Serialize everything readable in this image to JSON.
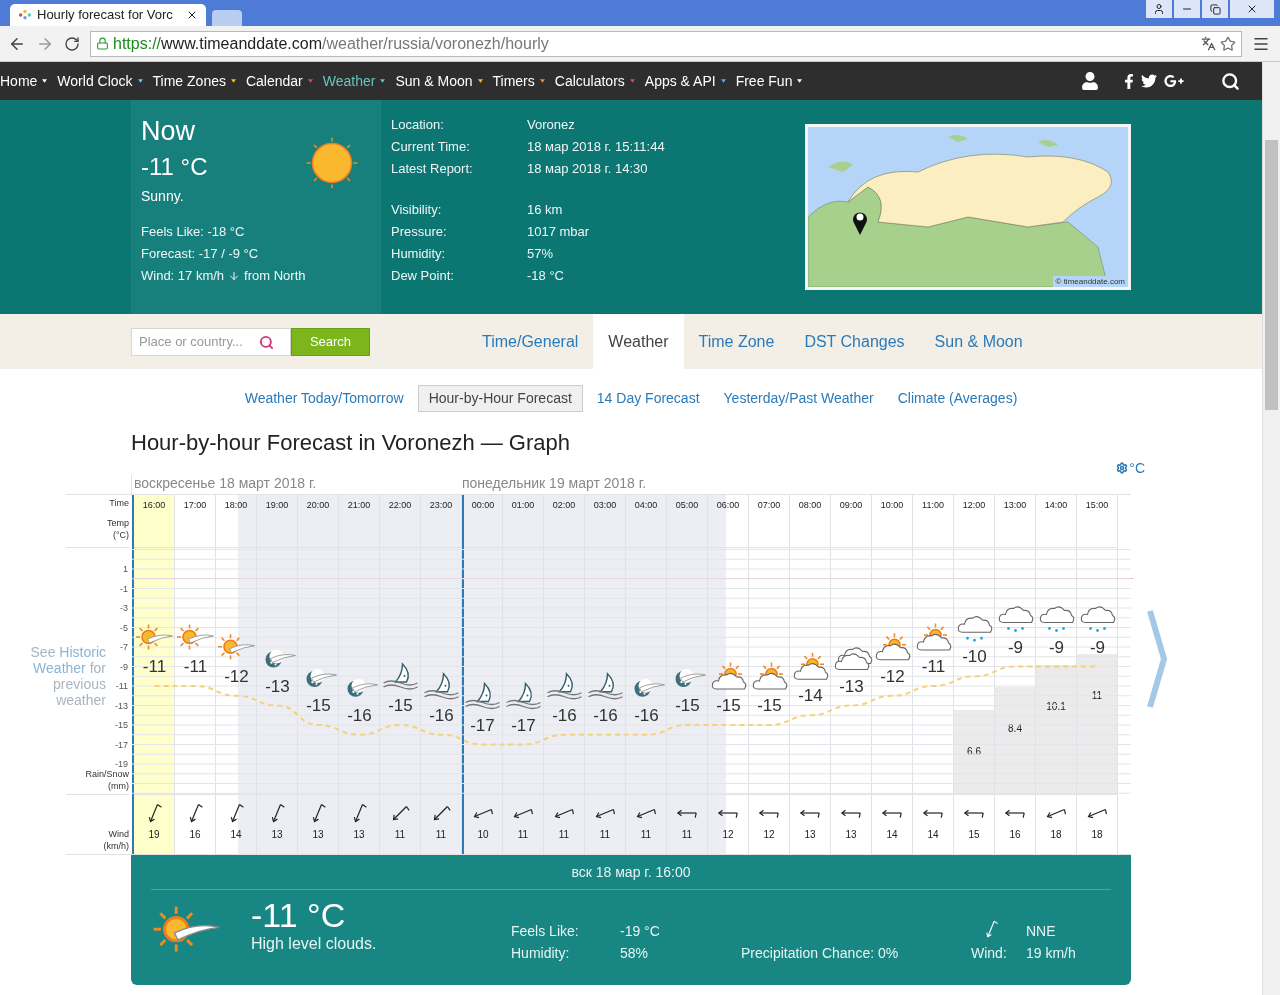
{
  "browser": {
    "tab_title": "Hourly forecast for Vorc",
    "url_scheme": "https://",
    "url_host": "www.timeanddate.com",
    "url_path": "/weather/russia/voronezh/hourly"
  },
  "nav": {
    "items": [
      {
        "label": "Home",
        "selected": false,
        "color": "#ffffff"
      },
      {
        "label": "World Clock",
        "selected": false,
        "color": "#6ec6e6"
      },
      {
        "label": "Time Zones",
        "selected": false,
        "color": "#f2c12e"
      },
      {
        "label": "Calendar",
        "selected": false,
        "color": "#e04b4b"
      },
      {
        "label": "Weather",
        "selected": true,
        "color": "#65c4bc"
      },
      {
        "label": "Sun & Moon",
        "selected": false,
        "color": "#f2c12e"
      },
      {
        "label": "Timers",
        "selected": false,
        "color": "#f08a3c"
      },
      {
        "label": "Calculators",
        "selected": false,
        "color": "#e04b4b"
      },
      {
        "label": "Apps & API",
        "selected": false,
        "color": "#6ea0e6"
      },
      {
        "label": "Free Fun",
        "selected": false,
        "color": "#ffffff"
      }
    ]
  },
  "now": {
    "title": "Now",
    "temp": "-11 °C",
    "condition": "Sunny.",
    "lines": [
      "Feels Like: -18 °C",
      "Forecast: -17 / -9 °C"
    ],
    "wind_speed": "Wind: 17 km/h",
    "wind_direction": "from North"
  },
  "detail_groups": [
    {
      "rows": [
        {
          "label": "Location:",
          "value": "Voronez"
        },
        {
          "label": "Current Time:",
          "value": "18 мар 2018 г. 15:11:44"
        },
        {
          "label": "Latest Report:",
          "value": "18 мар 2018 г. 14:30"
        }
      ]
    },
    {
      "rows": [
        {
          "label": "Visibility:",
          "value": "16 km"
        },
        {
          "label": "Pressure:",
          "value": "1017 mbar"
        },
        {
          "label": "Humidity:",
          "value": "57%"
        },
        {
          "label": "Dew Point:",
          "value": "-18 °C"
        }
      ]
    }
  ],
  "map": {
    "credit": "© timeanddate.com"
  },
  "search": {
    "placeholder": "Place or country...",
    "button": "Search"
  },
  "section_tabs": [
    {
      "label": "Time/General",
      "selected": false
    },
    {
      "label": "Weather",
      "selected": true
    },
    {
      "label": "Time Zone",
      "selected": false
    },
    {
      "label": "DST Changes",
      "selected": false
    },
    {
      "label": "Sun & Moon",
      "selected": false
    }
  ],
  "sub_tabs": [
    {
      "label": "Weather Today/Tomorrow",
      "selected": false
    },
    {
      "label": "Hour-by-Hour Forecast",
      "selected": true
    },
    {
      "label": "14 Day Forecast",
      "selected": false
    },
    {
      "label": "Yesterday/Past Weather",
      "selected": false
    },
    {
      "label": "Climate (Averages)",
      "selected": false
    }
  ],
  "heading": "Hour-by-hour Forecast in Voronezh — Graph",
  "graph": {
    "unit": "°C",
    "dates": [
      "воскресенье 18 март 2018 г.",
      "понедельник 19 март 2018 г."
    ],
    "row_labels": {
      "time": [
        "Time"
      ],
      "precip": [
        "Rain/Snow",
        "(mm)"
      ],
      "wind": [
        "Wind",
        "(km/h)"
      ]
    },
    "side_link": [
      {
        "text": "See",
        "highlight": false
      },
      {
        "text": "Historic Weather",
        "highlight": true
      },
      {
        "text": "for previous weather",
        "highlight": false
      }
    ],
    "hours": [
      {
        "selected": true,
        "new_day": false,
        "night": false,
        "dusk": false,
        "dawn": false,
        "kind": "sun-high-cloud",
        "wind": "19",
        "wind_arrow": {
          "kind": "nne"
        }
      },
      {
        "selected": false,
        "new_day": false,
        "night": false,
        "dusk": false,
        "dawn": false,
        "kind": "sun-high-cloud",
        "wind": "16",
        "wind_arrow": {
          "kind": "nne"
        }
      },
      {
        "selected": false,
        "new_day": false,
        "night": false,
        "dusk": true,
        "dawn": false,
        "kind": "sun-high-cloud",
        "wind": "14",
        "wind_arrow": {
          "kind": "nne"
        }
      },
      {
        "selected": false,
        "new_day": false,
        "night": true,
        "dusk": false,
        "dawn": false,
        "kind": "moon-high-cloud",
        "wind": "13",
        "wind_arrow": {
          "kind": "nne"
        }
      },
      {
        "selected": false,
        "new_day": false,
        "night": true,
        "dusk": false,
        "dawn": false,
        "kind": "moon-high-cloud",
        "wind": "13",
        "wind_arrow": {
          "kind": "nne"
        }
      },
      {
        "selected": false,
        "new_day": false,
        "night": true,
        "dusk": false,
        "dawn": false,
        "kind": "moon-high-cloud",
        "wind": "13",
        "wind_arrow": {
          "kind": "nne"
        }
      },
      {
        "selected": false,
        "new_day": false,
        "night": true,
        "dusk": false,
        "dawn": false,
        "kind": "moon-fog",
        "wind": "11",
        "wind_arrow": {
          "kind": "ne"
        }
      },
      {
        "selected": false,
        "new_day": false,
        "night": true,
        "dusk": false,
        "dawn": false,
        "kind": "moon-fog",
        "wind": "11",
        "wind_arrow": {
          "kind": "ne"
        }
      },
      {
        "selected": false,
        "new_day": true,
        "night": true,
        "dusk": false,
        "dawn": false,
        "kind": "moon-fog",
        "wind": "10",
        "wind_arrow": {
          "kind": "ene"
        }
      },
      {
        "selected": false,
        "new_day": false,
        "night": true,
        "dusk": false,
        "dawn": false,
        "kind": "moon-fog",
        "wind": "11",
        "wind_arrow": {
          "kind": "ene"
        }
      },
      {
        "selected": false,
        "new_day": false,
        "night": true,
        "dusk": false,
        "dawn": false,
        "kind": "moon-fog",
        "wind": "11",
        "wind_arrow": {
          "kind": "ene"
        }
      },
      {
        "selected": false,
        "new_day": false,
        "night": true,
        "dusk": false,
        "dawn": false,
        "kind": "moon-fog",
        "wind": "11",
        "wind_arrow": {
          "kind": "ene"
        }
      },
      {
        "selected": false,
        "new_day": false,
        "night": true,
        "dusk": false,
        "dawn": false,
        "kind": "moon-high-cloud",
        "wind": "11",
        "wind_arrow": {
          "kind": "ene"
        }
      },
      {
        "selected": false,
        "new_day": false,
        "night": true,
        "dusk": false,
        "dawn": false,
        "kind": "moon-high-cloud",
        "wind": "11",
        "wind_arrow": {
          "kind": "e"
        }
      },
      {
        "selected": false,
        "new_day": false,
        "night": false,
        "dusk": false,
        "dawn": true,
        "kind": "sun-cloud",
        "wind": "12",
        "wind_arrow": {
          "kind": "e"
        }
      },
      {
        "selected": false,
        "new_day": false,
        "night": false,
        "dusk": false,
        "dawn": false,
        "kind": "sun-cloud",
        "wind": "12",
        "wind_arrow": {
          "kind": "e"
        }
      },
      {
        "selected": false,
        "new_day": false,
        "night": false,
        "dusk": false,
        "dawn": false,
        "kind": "sun-cloud",
        "wind": "13",
        "wind_arrow": {
          "kind": "e"
        }
      },
      {
        "selected": false,
        "new_day": false,
        "night": false,
        "dusk": false,
        "dawn": false,
        "kind": "cloud",
        "wind": "13",
        "wind_arrow": {
          "kind": "e"
        }
      },
      {
        "selected": false,
        "new_day": false,
        "night": false,
        "dusk": false,
        "dawn": false,
        "kind": "sun-cloud",
        "wind": "14",
        "wind_arrow": {
          "kind": "e"
        }
      },
      {
        "selected": false,
        "new_day": false,
        "night": false,
        "dusk": false,
        "dawn": false,
        "kind": "sun-cloud",
        "wind": "14",
        "wind_arrow": {
          "kind": "e"
        }
      },
      {
        "selected": false,
        "new_day": false,
        "night": false,
        "dusk": false,
        "dawn": false,
        "kind": "snow",
        "wind": "15",
        "wind_arrow": {
          "kind": "e"
        },
        "precip": "6.6"
      },
      {
        "selected": false,
        "new_day": false,
        "night": false,
        "dusk": false,
        "dawn": false,
        "kind": "snow",
        "wind": "16",
        "wind_arrow": {
          "kind": "e"
        },
        "precip": "8.4"
      },
      {
        "selected": false,
        "new_day": false,
        "night": false,
        "dusk": false,
        "dawn": false,
        "kind": "snow",
        "wind": "18",
        "wind_arrow": {
          "kind": "ene"
        },
        "precip": "10.1"
      },
      {
        "selected": false,
        "new_day": false,
        "night": false,
        "dusk": false,
        "dawn": false,
        "kind": "snow",
        "wind": "18",
        "wind_arrow": {
          "kind": "ene"
        },
        "precip": "11"
      }
    ],
    "chart_data": {
      "type": "line",
      "categories": [
        "16:00",
        "17:00",
        "18:00",
        "19:00",
        "20:00",
        "21:00",
        "22:00",
        "23:00",
        "00:00",
        "01:00",
        "02:00",
        "03:00",
        "04:00",
        "05:00",
        "06:00",
        "07:00",
        "08:00",
        "09:00",
        "10:00",
        "11:00",
        "12:00",
        "13:00",
        "14:00",
        "15:00"
      ],
      "series": [
        {
          "name": "Temp (°C)",
          "color": "#f5d27a",
          "line_style": "dashed",
          "values": [
            -11,
            -11,
            -12,
            -13,
            -15,
            -16,
            -15,
            -16,
            -17,
            -17,
            -16,
            -16,
            -16,
            -15,
            -15,
            -15,
            -14,
            -13,
            -12,
            -11,
            -10,
            -9,
            -9,
            -9
          ]
        }
      ],
      "ylim": [
        -28.23,
        8.59
      ],
      "yticks": [
        1,
        -1,
        -3,
        -5,
        -7,
        -9,
        -11,
        -13,
        -15,
        -17,
        -19
      ],
      "grid": true,
      "data_labels": true
    }
  },
  "selected_detail": {
    "date": "вск 18 мар г. 16:00",
    "kind": "sun-high-cloud",
    "temp": "-11 °C",
    "condition": "High level clouds.",
    "feels_label": "Feels Like:",
    "feels_value": "-19 °C",
    "humidity_label": "Humidity:",
    "humidity_value": "58%",
    "precip_chance": "Precipitation Chance: 0%",
    "wind_from": "NNE",
    "wind_label": "Wind:",
    "wind_value": "19 km/h"
  }
}
